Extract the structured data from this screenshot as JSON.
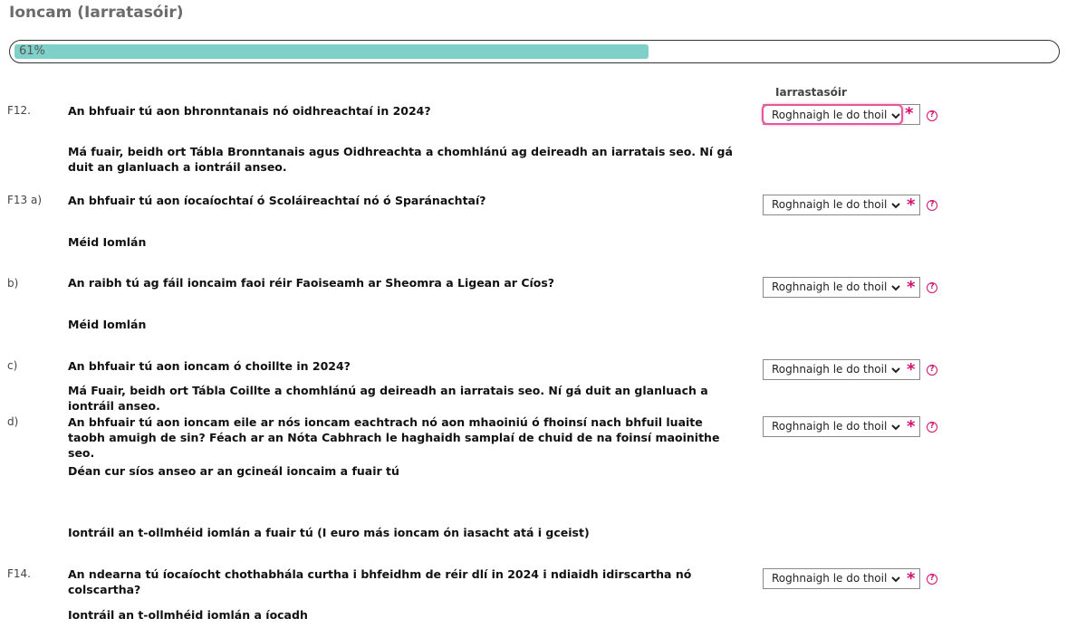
{
  "page": {
    "title": "Ioncam (Iarratasóir)"
  },
  "progress": {
    "label": "61%",
    "value": 0.61
  },
  "column_header": "Iarrastasóir",
  "select_placeholder": "Roghnaigh le do thoil",
  "required_mark": "*",
  "help_glyph": "?",
  "colors": {
    "accent": "#d1136f",
    "progress_fill": "#7ed0c9",
    "focus_border": "#e6569a"
  },
  "questions": [
    {
      "num": "F12.",
      "text": "An bhfuair tú aon bhronntanais nó oidhreachtaí in 2024?",
      "subtext": "Má fuair, beidh ort Tábla Bronntanais agus Oidhreachta a chomhlánú ag deireadh an iarratais seo. Ní gá duit an glanluach a iontráil anseo."
    },
    {
      "num": "F13 a)",
      "text": "An bhfuair tú aon íocaíochtaí ó Scoláireachtaí nó ó Sparánachtaí?",
      "subtext": "Méid Iomlán"
    },
    {
      "num": "b)",
      "text": "An raibh tú ag fáil ioncaim faoi réir Faoiseamh ar Sheomra a Ligean ar Cíos?",
      "subtext": "Méid Iomlán"
    },
    {
      "num": "c)",
      "text": "An bhfuair tú aon ioncam ó choillte in 2024?",
      "subtext": "Má Fuair, beidh ort Tábla Coillte a chomhlánú ag deireadh an iarratais seo. Ní gá duit an glanluach a iontráil anseo."
    },
    {
      "num": "d)",
      "text": "An bhfuair tú aon ioncam eile ar nós ioncam eachtrach nó aon mhaoiniú ó fhoinsí nach bhfuil luaite taobh amuigh de sin? Féach ar an Nóta Cabhrach le haghaidh samplaí de chuid de na foinsí maoinithe seo.",
      "subtext": "Déan cur síos anseo ar an gcineál ioncaim a fuair tú",
      "subtext2": "Iontráil an t-ollmhéid iomlán a fuair tú (I euro más ioncam ón iasacht atá i gceist)"
    },
    {
      "num": "F14.",
      "text": "An ndearna tú íocaíocht chothabhála curtha i bhfeidhm de réir dlí in 2024 i ndiaidh idirscartha nó colscartha?",
      "subtext": "Iontráil an t-ollmhéid iomlán a íocadh"
    }
  ]
}
